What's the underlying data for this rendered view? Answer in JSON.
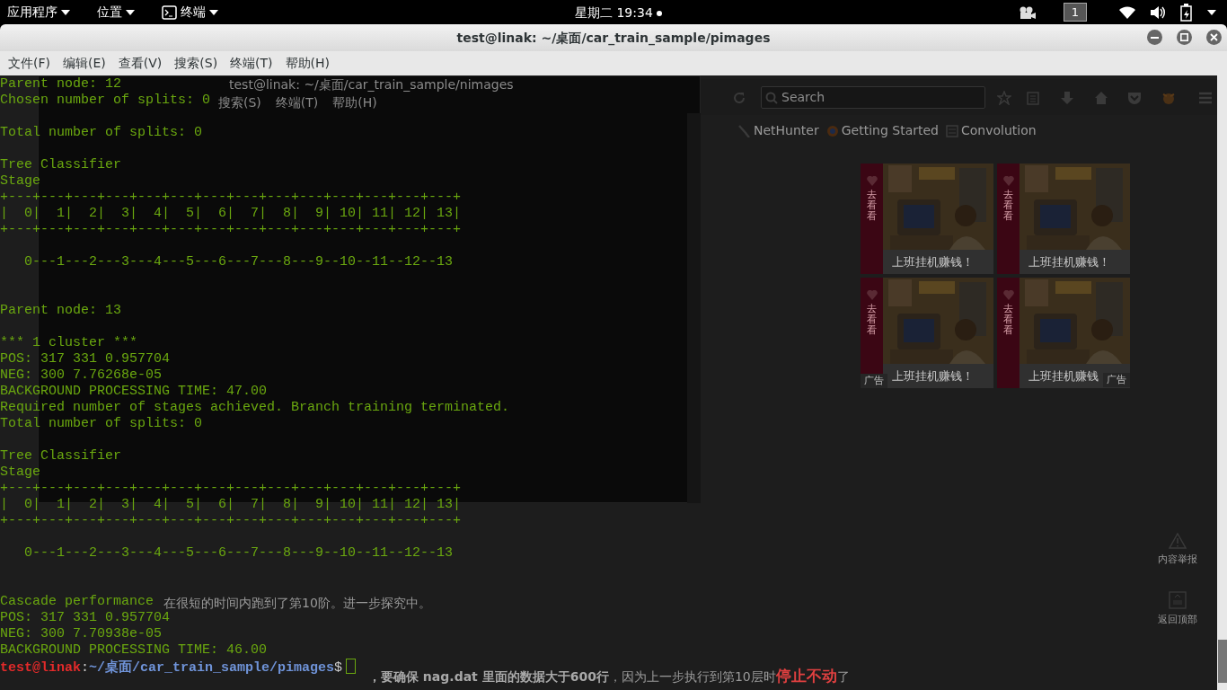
{
  "top_bar": {
    "menus": [
      {
        "label": "应用程序",
        "kind": "plain"
      },
      {
        "label": "位置",
        "kind": "plain"
      },
      {
        "label": "终端",
        "kind": "terminal"
      }
    ],
    "clock": "星期二 19:34",
    "workspace": "1"
  },
  "window": {
    "title": "test@linak: ~/桌面/car_train_sample/pimages",
    "menu": [
      "文件(F)",
      "编辑(E)",
      "查看(V)",
      "搜索(S)",
      "终端(T)",
      "帮助(H)"
    ]
  },
  "back_terminal": {
    "title": "test@linak: ~/桌面/car_train_sample/nimages",
    "menu": [
      "搜索(S)",
      "终端(T)",
      "帮助(H)"
    ]
  },
  "browser": {
    "search_placeholder": "Search",
    "bookmarks": [
      "NetHunter",
      "Getting Started",
      "Convolution"
    ],
    "ads": [
      {
        "side_label": "去看看",
        "caption": "上班挂机赚钱！"
      },
      {
        "side_label": "去看看",
        "caption": "上班挂机赚钱！"
      },
      {
        "side_label": "去看看",
        "caption": "上班挂机赚钱！",
        "ad_tag": "广告"
      },
      {
        "side_label": "去看看",
        "caption": "上班挂机赚钱",
        "ad_tag": "广告"
      }
    ],
    "side_buttons": [
      {
        "label": "内容举报",
        "kind": "report"
      },
      {
        "label": "返回顶部",
        "kind": "top"
      }
    ]
  },
  "article": {
    "lines": [
      {
        "parts": [
          {
            "text": "在很短的时间内跑到了第10阶。进一步探究中。",
            "kind": "plain"
          }
        ]
      },
      {
        "parts": [
          {
            "text": "，要确保 nag.dat 里面的数据大于600行",
            "kind": "bold"
          },
          {
            "text": "，因为上一步执行到第10层时",
            "kind": "plain"
          },
          {
            "text": "停止不动",
            "kind": "red"
          },
          {
            "text": "了",
            "kind": "plain"
          }
        ]
      }
    ]
  },
  "terminal": {
    "lines": [
      {
        "kind": "output",
        "text": "Parent node: 12"
      },
      {
        "kind": "output",
        "text": "Chosen number of splits: 0"
      },
      {
        "kind": "blank"
      },
      {
        "kind": "output",
        "text": "Total number of splits: 0"
      },
      {
        "kind": "blank"
      },
      {
        "kind": "output",
        "text": "Tree Classifier"
      },
      {
        "kind": "output",
        "text": "Stage"
      },
      {
        "kind": "output",
        "text": "+---+---+---+---+---+---+---+---+---+---+---+---+---+---+"
      },
      {
        "kind": "output",
        "text": "|  0|  1|  2|  3|  4|  5|  6|  7|  8|  9| 10| 11| 12| 13|"
      },
      {
        "kind": "output",
        "text": "+---+---+---+---+---+---+---+---+---+---+---+---+---+---+"
      },
      {
        "kind": "blank"
      },
      {
        "kind": "output",
        "text": "   0---1---2---3---4---5---6---7---8---9--10--11--12--13"
      },
      {
        "kind": "blank"
      },
      {
        "kind": "blank"
      },
      {
        "kind": "output",
        "text": "Parent node: 13"
      },
      {
        "kind": "blank"
      },
      {
        "kind": "output",
        "text": "*** 1 cluster ***"
      },
      {
        "kind": "output",
        "text": "POS: 317 331 0.957704"
      },
      {
        "kind": "output",
        "text": "NEG: 300 7.76268e-05"
      },
      {
        "kind": "output",
        "text": "BACKGROUND PROCESSING TIME: 47.00"
      },
      {
        "kind": "output",
        "text": "Required number of stages achieved. Branch training terminated."
      },
      {
        "kind": "output",
        "text": "Total number of splits: 0"
      },
      {
        "kind": "blank"
      },
      {
        "kind": "output",
        "text": "Tree Classifier"
      },
      {
        "kind": "output",
        "text": "Stage"
      },
      {
        "kind": "output",
        "text": "+---+---+---+---+---+---+---+---+---+---+---+---+---+---+"
      },
      {
        "kind": "output",
        "text": "|  0|  1|  2|  3|  4|  5|  6|  7|  8|  9| 10| 11| 12| 13|"
      },
      {
        "kind": "output",
        "text": "+---+---+---+---+---+---+---+---+---+---+---+---+---+---+"
      },
      {
        "kind": "blank"
      },
      {
        "kind": "output",
        "text": "   0---1---2---3---4---5---6---7---8---9--10--11--12--13"
      },
      {
        "kind": "blank"
      },
      {
        "kind": "blank"
      },
      {
        "kind": "output",
        "text": "Cascade performance"
      },
      {
        "kind": "output",
        "text": "POS: 317 331 0.957704"
      },
      {
        "kind": "output",
        "text": "NEG: 300 7.70938e-05"
      },
      {
        "kind": "output",
        "text": "BACKGROUND PROCESSING TIME: 46.00"
      },
      {
        "kind": "prompt",
        "user": "test@linak",
        "separator": ":",
        "path": "~/桌面/car_train_sample/pimages",
        "symbol": "$"
      }
    ]
  }
}
